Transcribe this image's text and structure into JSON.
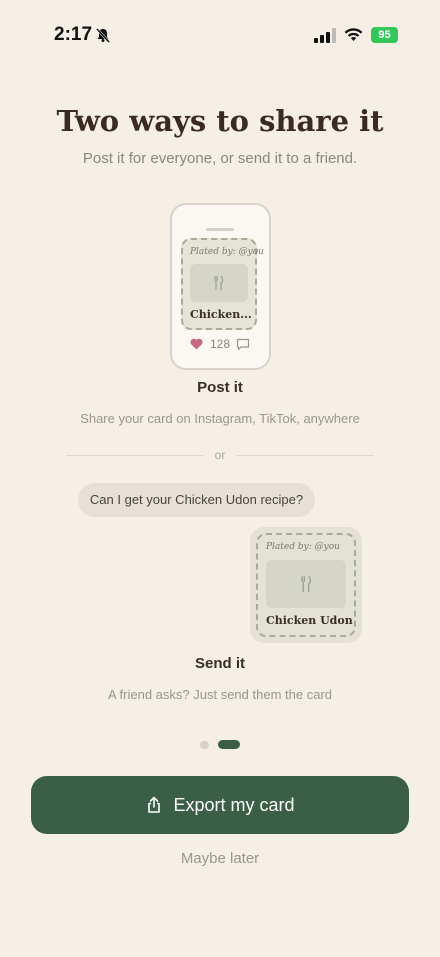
{
  "status_bar": {
    "time": "2:17",
    "battery": "95"
  },
  "title": "Two ways to share it",
  "subtitle": "Post it for everyone, or send it to a friend.",
  "post": {
    "card_plated": "Plated by: @you",
    "card_name": "Chicken...",
    "likes": "128",
    "heading": "Post it",
    "description": "Share your card on Instagram, TikTok, anywhere"
  },
  "divider": "or",
  "send": {
    "message": "Can I get your Chicken Udon recipe?",
    "card_plated": "Plated by: @you",
    "card_name": "Chicken Udon",
    "heading": "Send it",
    "description": "A friend asks? Just send them the card"
  },
  "pagination": {
    "current": 2,
    "total": 2
  },
  "export_label": "Export my card",
  "maybe_label": "Maybe later",
  "colors": {
    "accent": "#3b5e47",
    "background": "#f5efe6",
    "heart": "#c8697f"
  },
  "icons": {
    "fork_knife": "fork-knife-icon",
    "share": "share-icon"
  }
}
